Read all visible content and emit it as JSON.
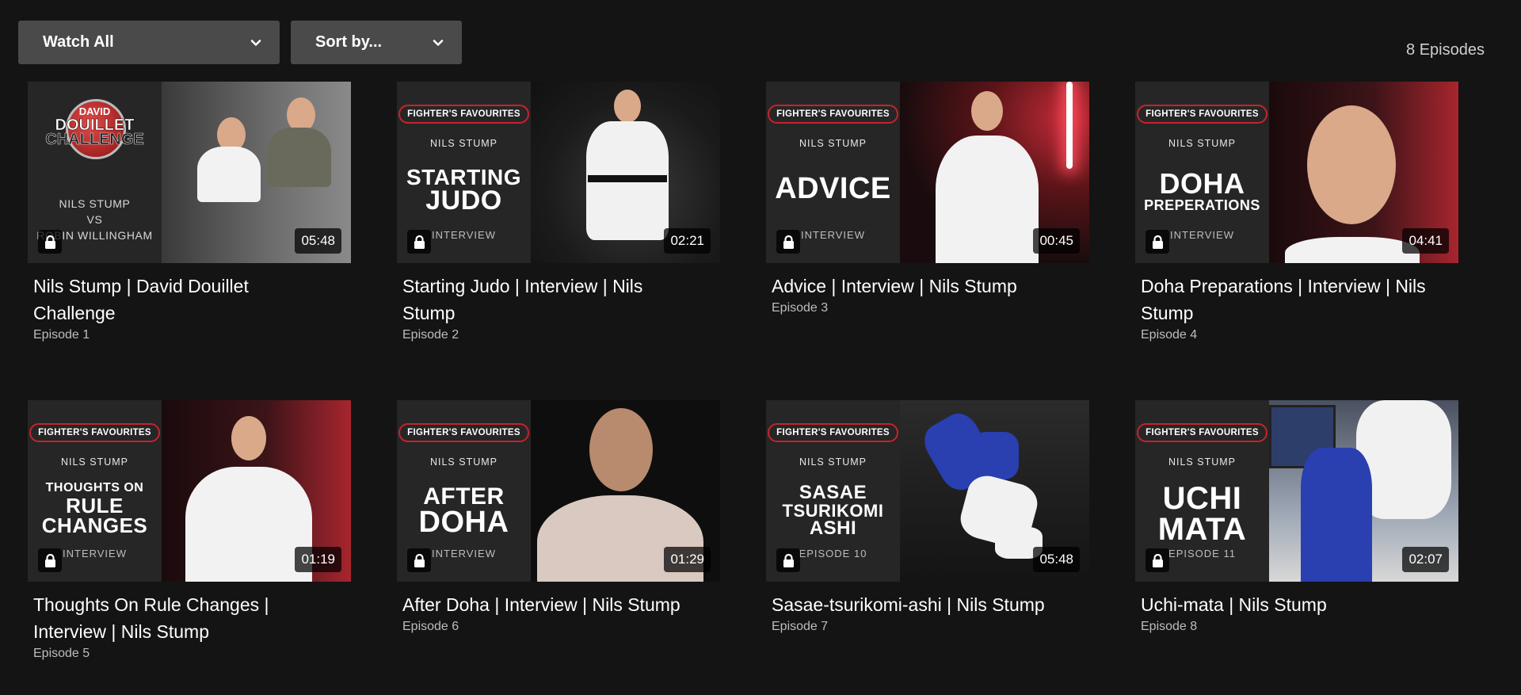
{
  "toolbar": {
    "watch_label": "Watch All",
    "sort_label": "Sort by..."
  },
  "episode_count": "8 Episodes",
  "episodes": [
    {
      "title": "Nils Stump | David Douillet Challenge",
      "episode": "Episode 1",
      "duration": "05:48",
      "poster": {
        "logo_line1": "DAVID",
        "logo_line2": "DOUILLET",
        "logo_line3": "CHALLENGE",
        "vs_line1": "NILS STUMP",
        "vs_line2": "VS",
        "vs_line3": "ROBIN WILLINGHAM"
      }
    },
    {
      "title": "Starting Judo | Interview | Nils Stump",
      "episode": "Episode 2",
      "duration": "02:21",
      "poster": {
        "badge": "FIGHTER'S FAVOURITES",
        "fighter": "NILS STUMP",
        "title_l1": "STARTING",
        "title_l2": "JUDO",
        "type": "INTERVIEW"
      }
    },
    {
      "title": "Advice | Interview | Nils Stump",
      "episode": "Episode 3",
      "duration": "00:45",
      "poster": {
        "badge": "FIGHTER'S FAVOURITES",
        "fighter": "NILS STUMP",
        "title_l1": "ADVICE",
        "title_l2": "",
        "type": "INTERVIEW"
      }
    },
    {
      "title": "Doha Preparations | Interview | Nils Stump",
      "episode": "Episode 4",
      "duration": "04:41",
      "poster": {
        "badge": "FIGHTER'S FAVOURITES",
        "fighter": "NILS STUMP",
        "title_l1": "DOHA",
        "title_l2": "PREPERATIONS",
        "type": "INTERVIEW"
      }
    },
    {
      "title": "Thoughts On Rule Changes | Interview | Nils Stump",
      "episode": "Episode 5",
      "duration": "01:19",
      "poster": {
        "badge": "FIGHTER'S FAVOURITES",
        "fighter": "NILS STUMP",
        "title_l0": "THOUGHTS ON",
        "title_l1": "RULE",
        "title_l2": "CHANGES",
        "type": "INTERVIEW"
      }
    },
    {
      "title": "After Doha | Interview | Nils Stump",
      "episode": "Episode 6",
      "duration": "01:29",
      "poster": {
        "badge": "FIGHTER'S FAVOURITES",
        "fighter": "NILS STUMP",
        "title_l1": "AFTER",
        "title_l2": "DOHA",
        "type": "INTERVIEW"
      }
    },
    {
      "title": "Sasae-tsurikomi-ashi | Nils Stump",
      "episode": "Episode 7",
      "duration": "05:48",
      "poster": {
        "badge": "FIGHTER'S FAVOURITES",
        "fighter": "NILS STUMP",
        "title_l0": "SASAE",
        "title_l1": "TSURIKOMI",
        "title_l2": "ASHI",
        "type": "EPISODE 10"
      }
    },
    {
      "title": "Uchi-mata | Nils Stump",
      "episode": "Episode 8",
      "duration": "02:07",
      "poster": {
        "badge": "FIGHTER'S FAVOURITES",
        "fighter": "NILS STUMP",
        "title_l1": "UCHI",
        "title_l2": "MATA",
        "type": "EPISODE 11"
      }
    }
  ],
  "icons": {
    "dropdown": "chevron-down-icon",
    "locked": "lock-icon"
  }
}
